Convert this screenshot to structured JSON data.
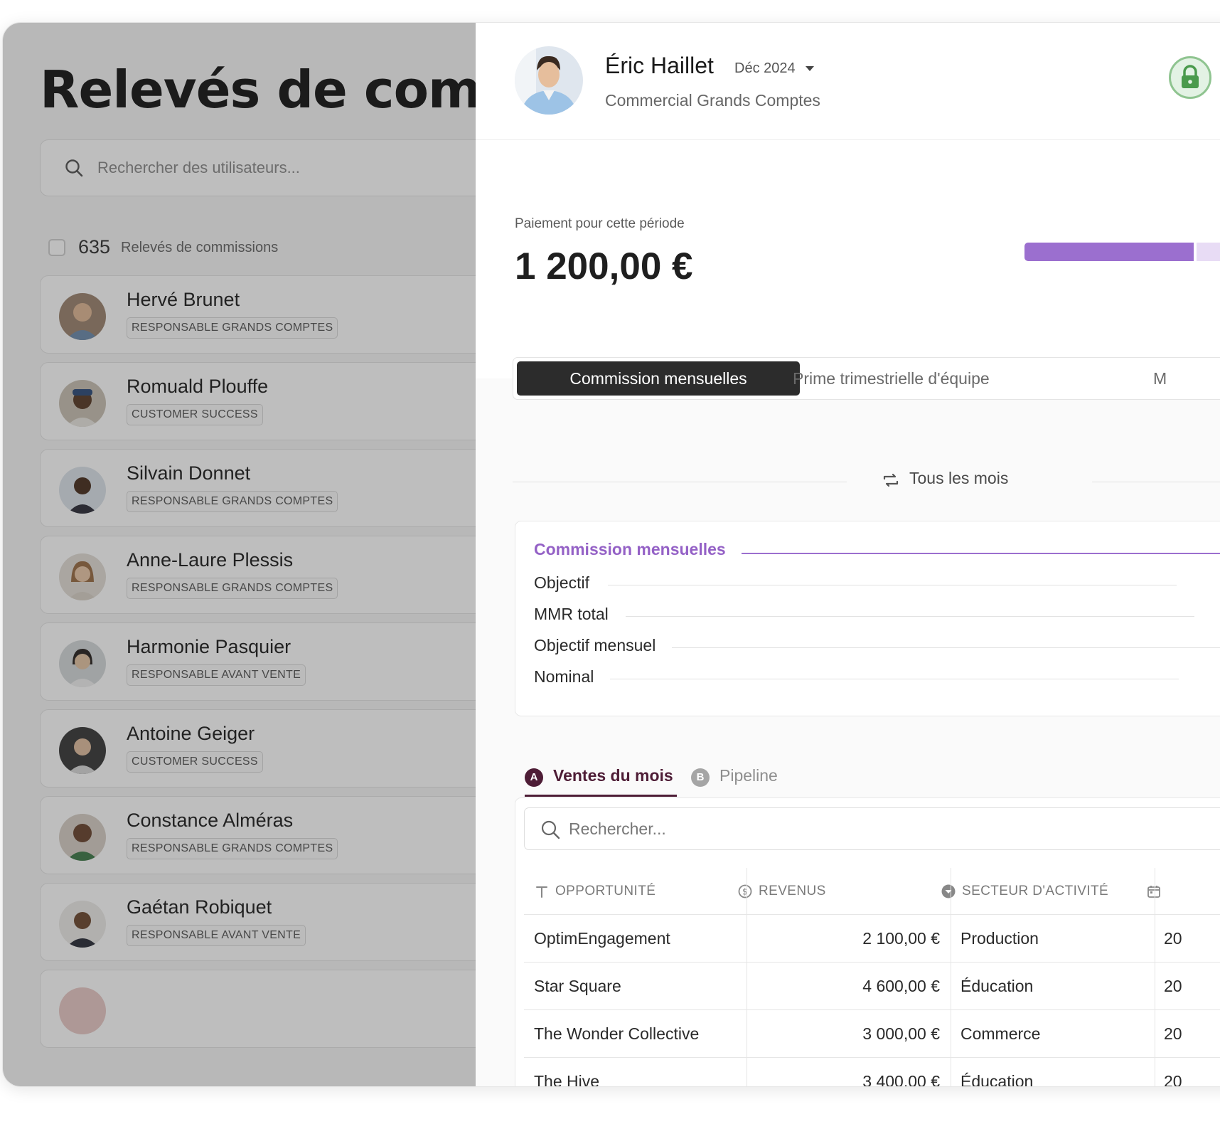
{
  "list": {
    "title": "Relevés de comm",
    "search_placeholder": "Rechercher des utilisateurs...",
    "count": "635",
    "count_label": "Relevés de commissions",
    "users": [
      {
        "name": "Hervé Brunet",
        "role": "RESPONSABLE GRANDS COMPTES"
      },
      {
        "name": "Romuald Plouffe",
        "role": "CUSTOMER SUCCESS"
      },
      {
        "name": "Silvain Donnet",
        "role": "RESPONSABLE GRANDS COMPTES"
      },
      {
        "name": "Anne-Laure Plessis",
        "role": "RESPONSABLE GRANDS COMPTES"
      },
      {
        "name": "Harmonie Pasquier",
        "role": "RESPONSABLE AVANT VENTE"
      },
      {
        "name": "Antoine Geiger",
        "role": "CUSTOMER SUCCESS"
      },
      {
        "name": "Constance Alméras",
        "role": "RESPONSABLE GRANDS COMPTES"
      },
      {
        "name": "Gaétan Robiquet",
        "role": "RESPONSABLE AVANT VENTE"
      }
    ]
  },
  "detail": {
    "name": "Éric Haillet",
    "period": "Déc 2024",
    "job": "Commercial Grands Comptes",
    "payment_label": "Paiement pour cette période",
    "payment_amount": "1 200,00 €",
    "progress_fraction": 0.7,
    "tabs": [
      "Commission mensuelles",
      "Prime trimestrielle d'équipe",
      "M"
    ],
    "recurrence": "Tous les mois",
    "plan": {
      "title": "Commission mensuelles",
      "rows": [
        "Objectif",
        "MMR total",
        "Objectif mensuel",
        "Nominal"
      ]
    },
    "subtabs": [
      {
        "badge": "A",
        "label": "Ventes du mois"
      },
      {
        "badge": "B",
        "label": "Pipeline"
      }
    ],
    "table_search_placeholder": "Rechercher...",
    "columns": [
      "OPPORTUNITÉ",
      "REVENUS",
      "SECTEUR D'ACTIVITÉ"
    ],
    "rows": [
      {
        "opportunity": "OptimEngagement",
        "revenue": "2 100,00 €",
        "sector": "Production",
        "date": "20"
      },
      {
        "opportunity": "Star Square",
        "revenue": "4 600,00 €",
        "sector": "Éducation",
        "date": "20"
      },
      {
        "opportunity": "The Wonder Collective",
        "revenue": "3 000,00 €",
        "sector": "Commerce",
        "date": "20"
      },
      {
        "opportunity": "The Hive",
        "revenue": "3 400,00 €",
        "sector": "Éducation",
        "date": "20"
      }
    ]
  },
  "colors": {
    "accent_purple": "#9b6fcf",
    "subtab_active": "#4e1d36",
    "lock_green": "#4a9a4c"
  }
}
